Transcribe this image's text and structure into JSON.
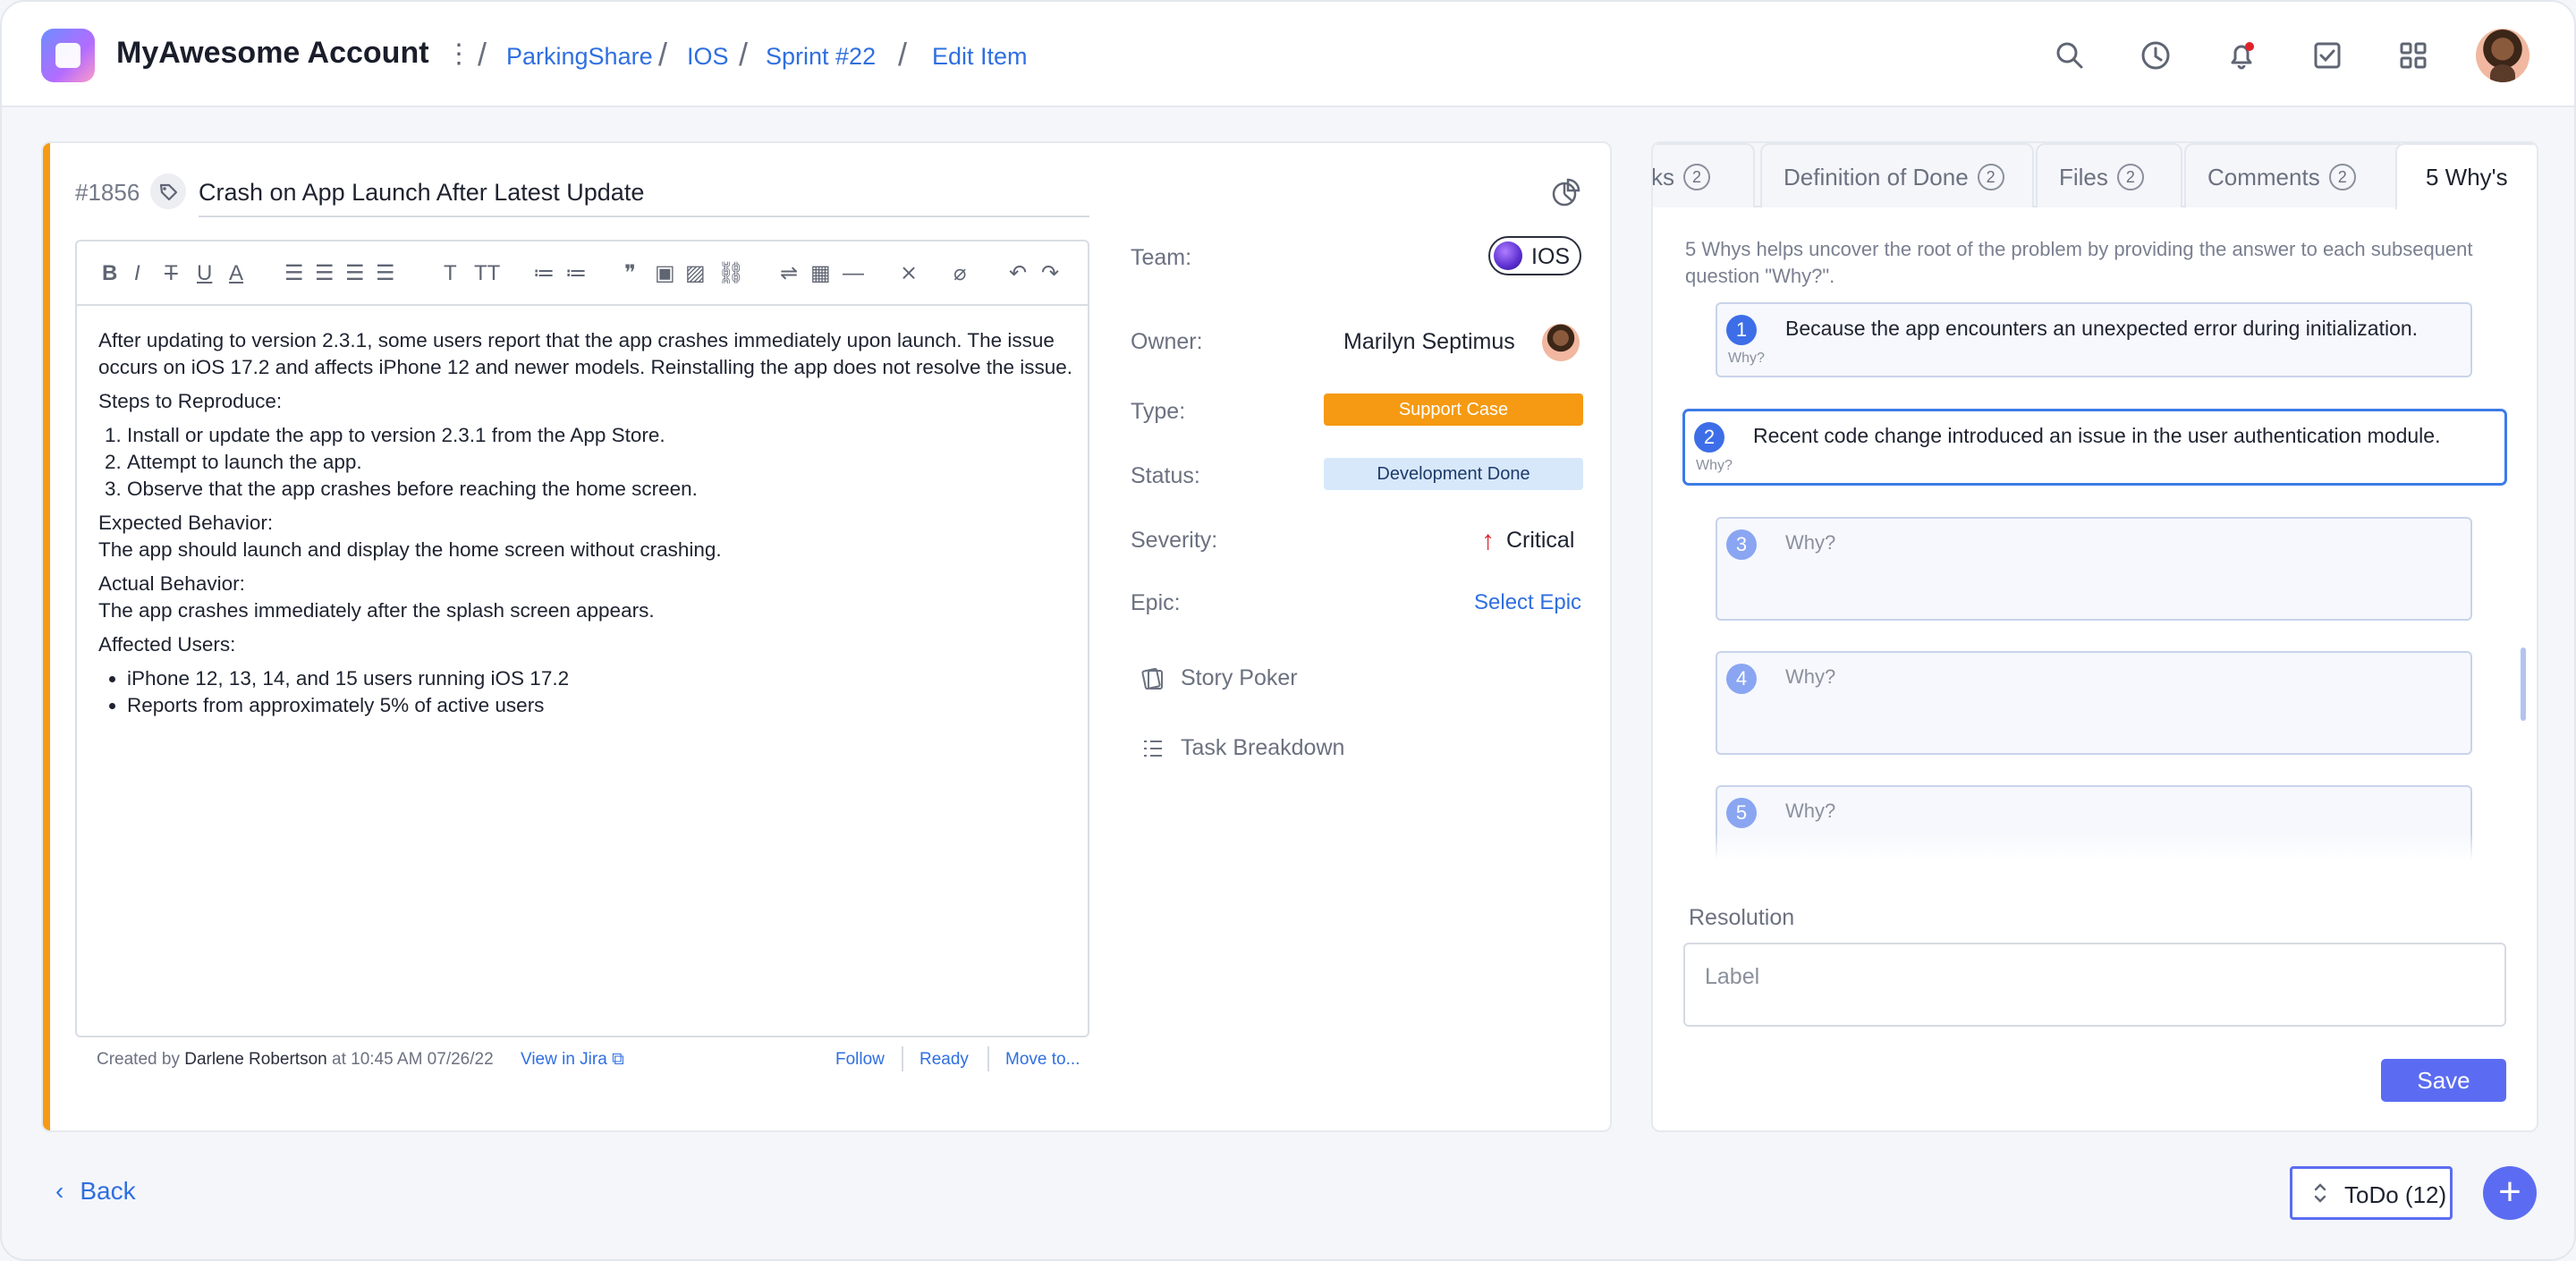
{
  "header": {
    "account_name": "MyAwesome Account",
    "breadcrumbs": [
      "ParkingShare",
      "IOS",
      "Sprint #22",
      "Edit Item"
    ],
    "icons": [
      "search-icon",
      "history-icon",
      "bell-icon",
      "checkbox-icon",
      "apps-grid-icon"
    ]
  },
  "item": {
    "number": "#1856",
    "title": "Crash on App Launch After Latest Update",
    "description": {
      "intro": "After updating to version 2.3.1, some users report that the app crashes immediately upon launch. The issue occurs on iOS 17.2 and affects iPhone 12 and newer models. Reinstalling the app does not resolve the issue.",
      "steps_heading": "Steps to Reproduce:",
      "steps": [
        "Install or update the app to version 2.3.1 from the App Store.",
        "Attempt to launch the app.",
        "Observe that the app crashes before reaching the home screen."
      ],
      "expected_heading": "Expected Behavior:",
      "expected": "The app should launch and display the home screen without crashing.",
      "actual_heading": "Actual Behavior:",
      "actual": "The app crashes immediately after the splash screen appears.",
      "affected_heading": "Affected Users:",
      "affected": [
        "iPhone 12, 13, 14, and 15 users running iOS 17.2",
        "Reports from approximately 5% of active users"
      ]
    },
    "footer": {
      "created_by_prefix": "Created by",
      "author": "Darlene Robertson",
      "created_at": "at 10:45 AM 07/26/22",
      "jira_link": "View in Jira",
      "follow": "Follow",
      "ready": "Ready",
      "move_to": "Move to..."
    }
  },
  "fields": {
    "team_label": "Team:",
    "team_value": "IOS",
    "owner_label": "Owner:",
    "owner_value": "Marilyn Septimus",
    "type_label": "Type:",
    "type_value": "Support Case",
    "type_color": "#f59a12",
    "status_label": "Status:",
    "status_value": "Development Done",
    "status_color": "#d7e8fb",
    "severity_label": "Severity:",
    "severity_value": "Critical",
    "epic_label": "Epic:",
    "epic_value": "Select Epic",
    "story_poker": "Story Poker",
    "task_breakdown": "Task Breakdown"
  },
  "tabs": [
    {
      "label": "ks",
      "count": "2"
    },
    {
      "label": "Definition of Done",
      "count": "2"
    },
    {
      "label": "Files",
      "count": "2"
    },
    {
      "label": "Comments",
      "count": "2"
    },
    {
      "label": "5 Why's",
      "count": ""
    }
  ],
  "five_whys": {
    "intro": "5 Whys helps uncover the root of the problem by providing the answer to each subsequent question \"Why?\".",
    "small_label": "Why?",
    "placeholder": "Why?",
    "items": [
      {
        "n": "1",
        "text": "Because the app encounters an unexpected error during initialization."
      },
      {
        "n": "2",
        "text": "Recent code change introduced an issue in the user authentication module."
      },
      {
        "n": "3",
        "text": ""
      },
      {
        "n": "4",
        "text": ""
      },
      {
        "n": "5",
        "text": ""
      }
    ],
    "resolution_label": "Resolution",
    "resolution_placeholder": "Label",
    "save_label": "Save"
  },
  "bottom": {
    "back_label": "Back",
    "todo_label": "ToDo (12)",
    "add_label": "+"
  }
}
